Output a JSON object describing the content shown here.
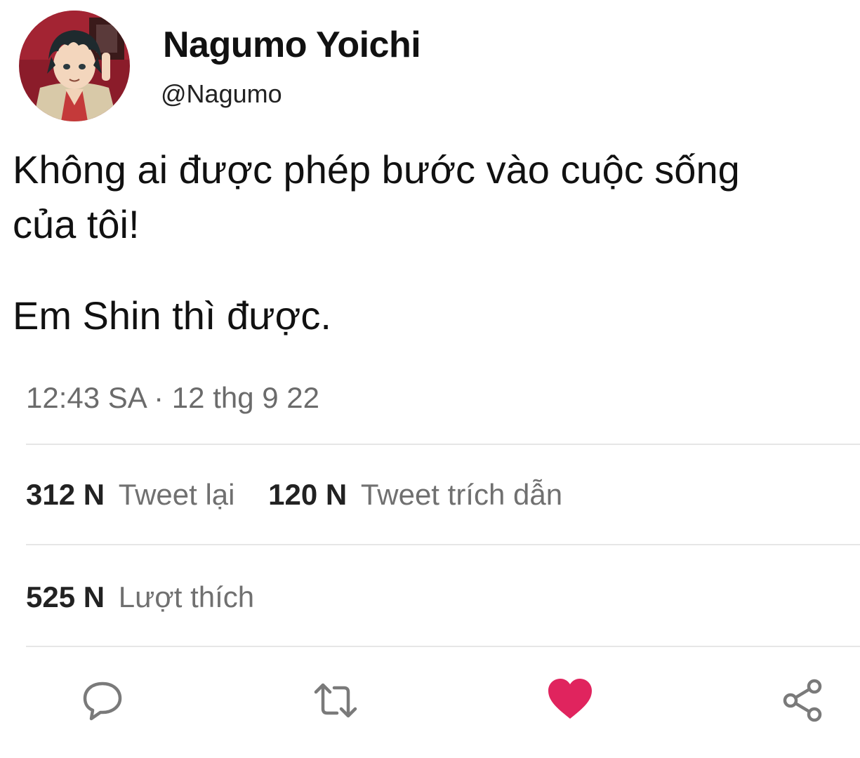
{
  "profile": {
    "display_name": "Nagumo Yoichi",
    "handle": "@Nagumo",
    "avatar_icon": "anime-character-avatar"
  },
  "tweet": {
    "line1": "Không ai được phép bước vào cuộc sống",
    "line2": "của tôi!",
    "line3": "Em Shin thì được.",
    "timestamp": "12:43 SA · 12 thg 9 22"
  },
  "stats": {
    "retweets_count": "312 N",
    "retweets_label": "Tweet lại",
    "quotes_count": "120 N",
    "quotes_label": "Tweet trích dẫn",
    "likes_count": "525 N",
    "likes_label": "Lượt thích"
  },
  "actions": {
    "reply_icon": "speech-bubble-icon",
    "retweet_icon": "retweet-icon",
    "like_icon": "heart-icon",
    "share_icon": "share-icon"
  },
  "colors": {
    "like": "#e0245e",
    "icon_gray": "#7a7a7a",
    "muted_text": "#6b6b6b",
    "divider": "#e6e6e6"
  }
}
